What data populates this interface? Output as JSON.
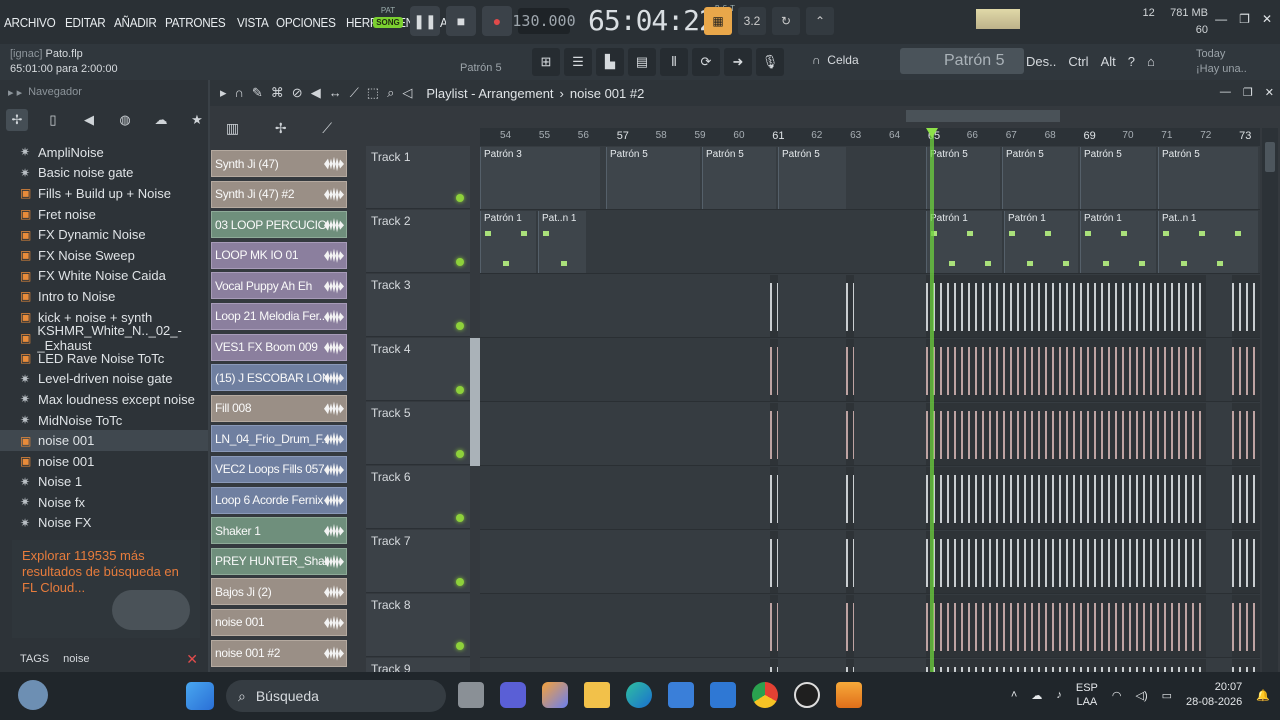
{
  "menu": [
    "ARCHIVO",
    "EDITAR",
    "AÑADIR",
    "PATRONES",
    "VISTA",
    "OPCIONES",
    "HERRAMIENTA",
    "AYU"
  ],
  "transport": {
    "pat": "PAT",
    "song": "SONG",
    "tempo": "130.000",
    "time": "65:04",
    "beat": "22",
    "bst": "B:S:T"
  },
  "sysinfo": {
    "cpu": "12",
    "ram": "781 MB",
    "poly": "60"
  },
  "project": {
    "user": "[ignac]",
    "file": "Pato.flp",
    "position": "65:01:00 para 2:00:00"
  },
  "pattern_label": "Patrón 5",
  "snap": "Celda",
  "pattern_selector": "Patrón 5",
  "hints": [
    "Des..",
    "Ctrl",
    "Alt"
  ],
  "today": {
    "label": "Today",
    "msg": "¡Hay una.."
  },
  "browser": {
    "title": "Navegador",
    "items": [
      {
        "label": "AmpliNoise",
        "icon": "gear"
      },
      {
        "label": "Basic noise gate",
        "icon": "gear"
      },
      {
        "label": "Fills + Build up + Noise",
        "icon": "folder"
      },
      {
        "label": "Fret noise",
        "icon": "folder"
      },
      {
        "label": "FX Dynamic Noise",
        "icon": "folder"
      },
      {
        "label": "FX Noise Sweep",
        "icon": "folder"
      },
      {
        "label": "FX White Noise Caida",
        "icon": "folder"
      },
      {
        "label": "Intro to Noise",
        "icon": "folder"
      },
      {
        "label": "kick + noise + synth",
        "icon": "folder"
      },
      {
        "label": "KSHMR_White_N.._02_-_Exhaust",
        "icon": "folder"
      },
      {
        "label": "LED Rave Noise ToTc",
        "icon": "folder"
      },
      {
        "label": "Level-driven noise gate",
        "icon": "gear"
      },
      {
        "label": "Max loudness except noise",
        "icon": "gear"
      },
      {
        "label": "MidNoise ToTc",
        "icon": "gear"
      },
      {
        "label": "noise 001",
        "icon": "folder",
        "selected": true
      },
      {
        "label": "noise 001",
        "icon": "folder"
      },
      {
        "label": "Noise 1",
        "icon": "gear"
      },
      {
        "label": "Noise fx",
        "icon": "gear"
      },
      {
        "label": "Noise FX",
        "icon": "gear"
      }
    ],
    "cloud_text": "Explorar 119535 más resultados de búsqueda en FL Cloud...",
    "tags_label": "TAGS",
    "tags_value": "noise"
  },
  "clips": [
    {
      "label": "Synth Ji (47)",
      "color": "tan"
    },
    {
      "label": "Synth Ji (47) #2",
      "color": "tan"
    },
    {
      "label": "03 LOOP PERCUCION..",
      "color": "green"
    },
    {
      "label": "LOOP MK IO 01",
      "color": "purple"
    },
    {
      "label": "Vocal Puppy Ah Eh",
      "color": "purple"
    },
    {
      "label": "Loop 21 Melodia Fer..",
      "color": "purple"
    },
    {
      "label": "VES1 FX Boom 009",
      "color": "purple"
    },
    {
      "label": "(15) J ESCOBAR LONG..",
      "color": "blue"
    },
    {
      "label": "Fill 008",
      "color": "tan"
    },
    {
      "label": "LN_04_Frio_Drum_F..",
      "color": "blue"
    },
    {
      "label": "VEC2 Loops Fills 057",
      "color": "blue"
    },
    {
      "label": "Loop 6 Acorde Fernix",
      "color": "blue"
    },
    {
      "label": "Shaker 1",
      "color": "green"
    },
    {
      "label": "PREY HUNTER_Shake..",
      "color": "green"
    },
    {
      "label": "Bajos Ji  (2)",
      "color": "tan"
    },
    {
      "label": "noise 001",
      "color": "tan"
    },
    {
      "label": "noise 001 #2",
      "color": "tan"
    }
  ],
  "playlist": {
    "title": "Playlist - Arrangement",
    "crumb": "noise 001 #2"
  },
  "ticks": [
    "54",
    "55",
    "56",
    "57",
    "58",
    "59",
    "60",
    "61",
    "62",
    "63",
    "64",
    "65",
    "66",
    "67",
    "68",
    "69",
    "70",
    "71",
    "72",
    "73"
  ],
  "tracks": [
    "Track 1",
    "Track 2",
    "Track 3",
    "Track 4",
    "Track 5",
    "Track 6",
    "Track 7",
    "Track 8",
    "Track 9"
  ],
  "track1_patterns": [
    "Patrón 3",
    "Patrón 5",
    "Patrón 5",
    "Patrón 5",
    "Patrón 5",
    "Patrón 5",
    "Patrón 5",
    "Patrón 5"
  ],
  "track2_patterns": [
    "Patrón 1",
    "Pat..n 1",
    "Patrón 1",
    "Patrón 1",
    "Patrón 1",
    "Pat..n 1"
  ],
  "taskbar": {
    "search": "Búsqueda",
    "lang1": "ESP",
    "lang2": "LAA",
    "time": "20:07",
    "date": "28-08-2026"
  }
}
